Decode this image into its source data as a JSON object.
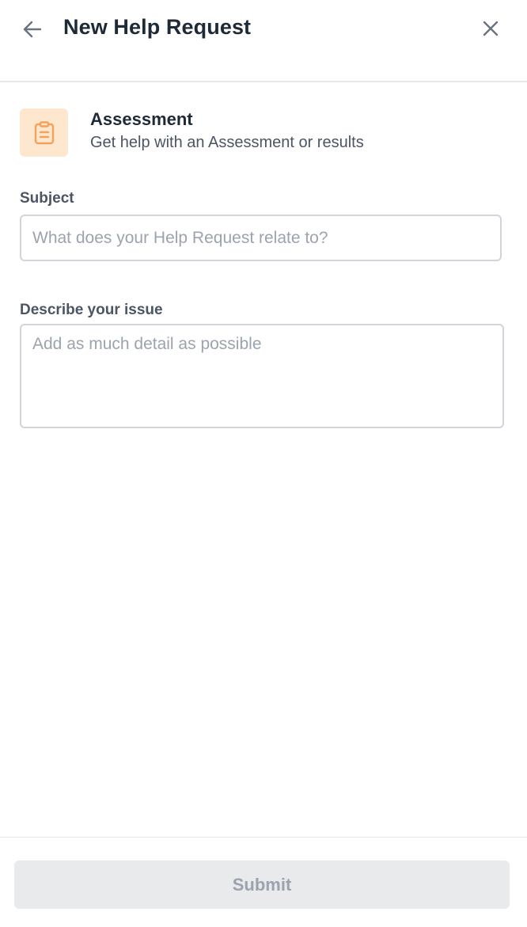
{
  "header": {
    "title": "New Help Request",
    "back_icon": "arrow-left-icon",
    "close_icon": "close-icon"
  },
  "category": {
    "icon": "clipboard-icon",
    "icon_color": "#f4a259",
    "icon_bg": "#fde7cf",
    "title": "Assessment",
    "description": "Get help with an Assessment or results"
  },
  "form": {
    "subject_label": "Subject",
    "subject_placeholder": "What does your Help Request relate to?",
    "subject_value": "",
    "issue_label": "Describe your issue",
    "issue_placeholder": "Add as much detail as possible",
    "issue_value": ""
  },
  "footer": {
    "submit_label": "Submit"
  }
}
